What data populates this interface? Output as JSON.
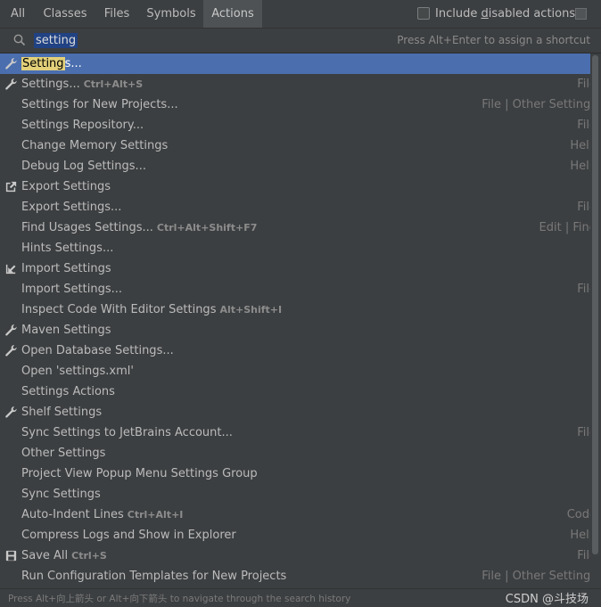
{
  "tabs": [
    {
      "label": "All"
    },
    {
      "label": "Classes"
    },
    {
      "label": "Files"
    },
    {
      "label": "Symbols"
    },
    {
      "label": "Actions",
      "active": true
    }
  ],
  "options": {
    "include_disabled_pre": "Include ",
    "include_disabled_u": "d",
    "include_disabled_post": "isabled actions",
    "checked": false
  },
  "search": {
    "value": "setting",
    "hint": "Press Alt+Enter to assign a shortcut"
  },
  "results": [
    {
      "icon": "wrench-icon",
      "label": "Setting",
      "suffix": "s...",
      "shortcut": "",
      "group": "",
      "selected": true
    },
    {
      "icon": "wrench-icon",
      "label": "Settings...",
      "shortcut": "Ctrl+Alt+S",
      "group": "File"
    },
    {
      "icon": "",
      "label": "Settings for New Projects...",
      "shortcut": "",
      "group": "File | Other Settings"
    },
    {
      "icon": "",
      "label": "Settings Repository...",
      "shortcut": "",
      "group": "File"
    },
    {
      "icon": "",
      "label": "Change Memory Settings",
      "shortcut": "",
      "group": "Help"
    },
    {
      "icon": "",
      "label": "Debug Log Settings...",
      "shortcut": "",
      "group": "Help"
    },
    {
      "icon": "export-icon",
      "label": "Export Settings",
      "shortcut": "",
      "group": ""
    },
    {
      "icon": "",
      "label": "Export Settings...",
      "shortcut": "",
      "group": "File"
    },
    {
      "icon": "",
      "label": "Find Usages Settings...",
      "shortcut": "Ctrl+Alt+Shift+F7",
      "group": "Edit | Find"
    },
    {
      "icon": "",
      "label": "Hints Settings...",
      "shortcut": "",
      "group": ""
    },
    {
      "icon": "import-icon",
      "label": "Import Settings",
      "shortcut": "",
      "group": ""
    },
    {
      "icon": "",
      "label": "Import Settings...",
      "shortcut": "",
      "group": "File"
    },
    {
      "icon": "",
      "label": "Inspect Code With Editor Settings",
      "shortcut": "Alt+Shift+I",
      "group": ""
    },
    {
      "icon": "wrench-icon",
      "label": "Maven Settings",
      "shortcut": "",
      "group": ""
    },
    {
      "icon": "wrench-icon",
      "label": "Open Database Settings...",
      "shortcut": "",
      "group": ""
    },
    {
      "icon": "",
      "label": "Open 'settings.xml'",
      "shortcut": "",
      "group": ""
    },
    {
      "icon": "",
      "label": "Settings Actions",
      "shortcut": "",
      "group": ""
    },
    {
      "icon": "wrench-icon",
      "label": "Shelf Settings",
      "shortcut": "",
      "group": ""
    },
    {
      "icon": "",
      "label": "Sync Settings to JetBrains Account...",
      "shortcut": "",
      "group": "File"
    },
    {
      "icon": "",
      "label": "Other Settings",
      "shortcut": "",
      "group": ""
    },
    {
      "icon": "",
      "label": "Project View Popup Menu Settings Group",
      "shortcut": "",
      "group": ""
    },
    {
      "icon": "",
      "label": "Sync Settings",
      "shortcut": "",
      "group": ""
    },
    {
      "icon": "",
      "label": "Auto-Indent Lines",
      "shortcut": "Ctrl+Alt+I",
      "group": "Code"
    },
    {
      "icon": "",
      "label": "Compress Logs and Show in Explorer",
      "shortcut": "",
      "group": "Help"
    },
    {
      "icon": "save-icon",
      "label": "Save All",
      "shortcut": "Ctrl+S",
      "group": "File"
    },
    {
      "icon": "",
      "label": "Run Configuration Templates for New Projects",
      "shortcut": "",
      "group": "File | Other Settings"
    }
  ],
  "footer": {
    "hint": "Press Alt+向上箭头 or Alt+向下箭头 to navigate through the search history",
    "watermark": "CSDN @斗技场"
  },
  "colors": {
    "background": "#3c3f41",
    "selection": "#4b6eaf",
    "match_highlight": "#e2d07a",
    "search_selection": "#214283"
  }
}
